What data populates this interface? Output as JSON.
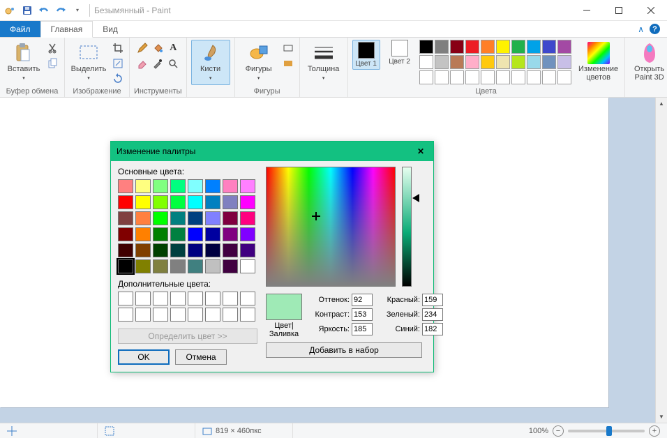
{
  "window": {
    "title": "Безымянный - Paint"
  },
  "tabs": {
    "file": "Файл",
    "home": "Главная",
    "view": "Вид"
  },
  "ribbon": {
    "clipboard": {
      "label": "Буфер обмена",
      "paste": "Вставить"
    },
    "image": {
      "label": "Изображение",
      "select": "Выделить"
    },
    "tools": {
      "label": "Инструменты"
    },
    "brushes": {
      "label": "Кисти"
    },
    "shapes": {
      "label": "Фигуры",
      "btn": "Фигуры"
    },
    "thickness": {
      "label": "Толщина"
    },
    "colors": {
      "label": "Цвета",
      "color1": "Цвет 1",
      "color2": "Цвет 2",
      "edit": "Изменение цветов",
      "open3d": "Открыть Paint 3D",
      "row1": [
        "#000000",
        "#7f7f7f",
        "#880015",
        "#ed1c24",
        "#ff7f27",
        "#fff200",
        "#22b14c",
        "#00a2e8",
        "#3f48cc",
        "#a349a4"
      ],
      "row2": [
        "#ffffff",
        "#c3c3c3",
        "#b97a57",
        "#ffaec9",
        "#ffc90e",
        "#efe4b0",
        "#b5e61d",
        "#99d9ea",
        "#7092be",
        "#c8bfe7"
      ],
      "row3": [
        "#ffffff",
        "#ffffff",
        "#ffffff",
        "#ffffff",
        "#ffffff",
        "#ffffff",
        "#ffffff",
        "#ffffff",
        "#ffffff",
        "#ffffff"
      ]
    }
  },
  "status": {
    "size": "819 × 460пкс",
    "zoom": "100%"
  },
  "dialog": {
    "title": "Изменение палитры",
    "basic_label": "Основные цвета:",
    "custom_label": "Дополнительные цвета:",
    "define": "Определить цвет >>",
    "ok": "OK",
    "cancel": "Отмена",
    "preview_label": "Цвет|Заливка",
    "hue_label": "Оттенок:",
    "sat_label": "Контраст:",
    "lum_label": "Яркость:",
    "red_label": "Красный:",
    "green_label": "Зеленый:",
    "blue_label": "Синий:",
    "hue": "92",
    "sat": "153",
    "lum": "185",
    "red": "159",
    "green": "234",
    "blue": "182",
    "add": "Добавить в набор",
    "basic_colors": [
      "#ff8080",
      "#ffff80",
      "#80ff80",
      "#00ff80",
      "#80ffff",
      "#0080ff",
      "#ff80c0",
      "#ff80ff",
      "#ff0000",
      "#ffff00",
      "#80ff00",
      "#00ff40",
      "#00ffff",
      "#0080c0",
      "#8080c0",
      "#ff00ff",
      "#804040",
      "#ff8040",
      "#00ff00",
      "#008080",
      "#004080",
      "#8080ff",
      "#800040",
      "#ff0080",
      "#800000",
      "#ff8000",
      "#008000",
      "#008040",
      "#0000ff",
      "#0000a0",
      "#800080",
      "#8000ff",
      "#400000",
      "#804000",
      "#004000",
      "#004040",
      "#000080",
      "#000040",
      "#400040",
      "#400080",
      "#000000",
      "#808000",
      "#808040",
      "#808080",
      "#408080",
      "#c0c0c0",
      "#400040",
      "#ffffff"
    ]
  }
}
